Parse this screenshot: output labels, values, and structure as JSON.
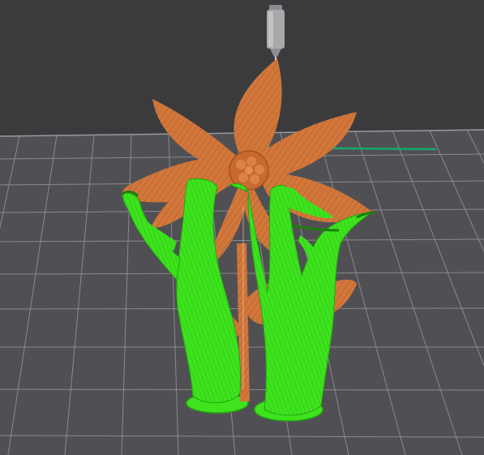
{
  "app": {
    "view": "slicer-preview-3d",
    "background_color": "#3b3b3e",
    "bed_color": "#505054",
    "grid_line_color": "#8a8a8e"
  },
  "scene": {
    "nozzle": {
      "icon": "extruder-nozzle-icon",
      "color": "#a9a9ac"
    },
    "model": {
      "shape": "flower",
      "material_color": "#d2773b",
      "highlight_color": "#f39a5a"
    },
    "supports": {
      "type": "tree",
      "color": "#3ee31e",
      "dark_color": "#23a80f"
    },
    "bed_edge_indicator_color": "#15a86a"
  }
}
